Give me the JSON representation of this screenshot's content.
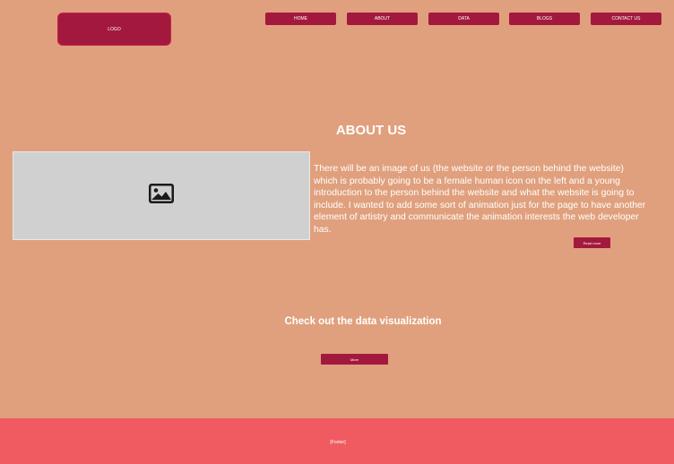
{
  "header": {
    "logo_label": "LOGO",
    "nav": [
      {
        "label": "HOME"
      },
      {
        "label": "ABOUT"
      },
      {
        "label": "DATA"
      },
      {
        "label": "BLOGS"
      },
      {
        "label": "CONTACT US"
      }
    ]
  },
  "about": {
    "title": "ABOUT US",
    "image_icon": "image-icon",
    "body": "There will be an image of us (the website or the person behind the website) which is probably going to be a female human icon on the left and a young introduction to the person behind the website and what the website is going to include. I wanted to add some sort of animation just for the page to have another element of artistry and communicate the animation interests the web developer has.",
    "read_more_label": "Read more"
  },
  "data_section": {
    "title": "Check out the data visualization",
    "button_label": "More"
  },
  "footer": {
    "text": "[Footer]"
  },
  "colors": {
    "background": "#e0a07d",
    "accent": "#a3193e",
    "footer": "#ef5b61"
  }
}
